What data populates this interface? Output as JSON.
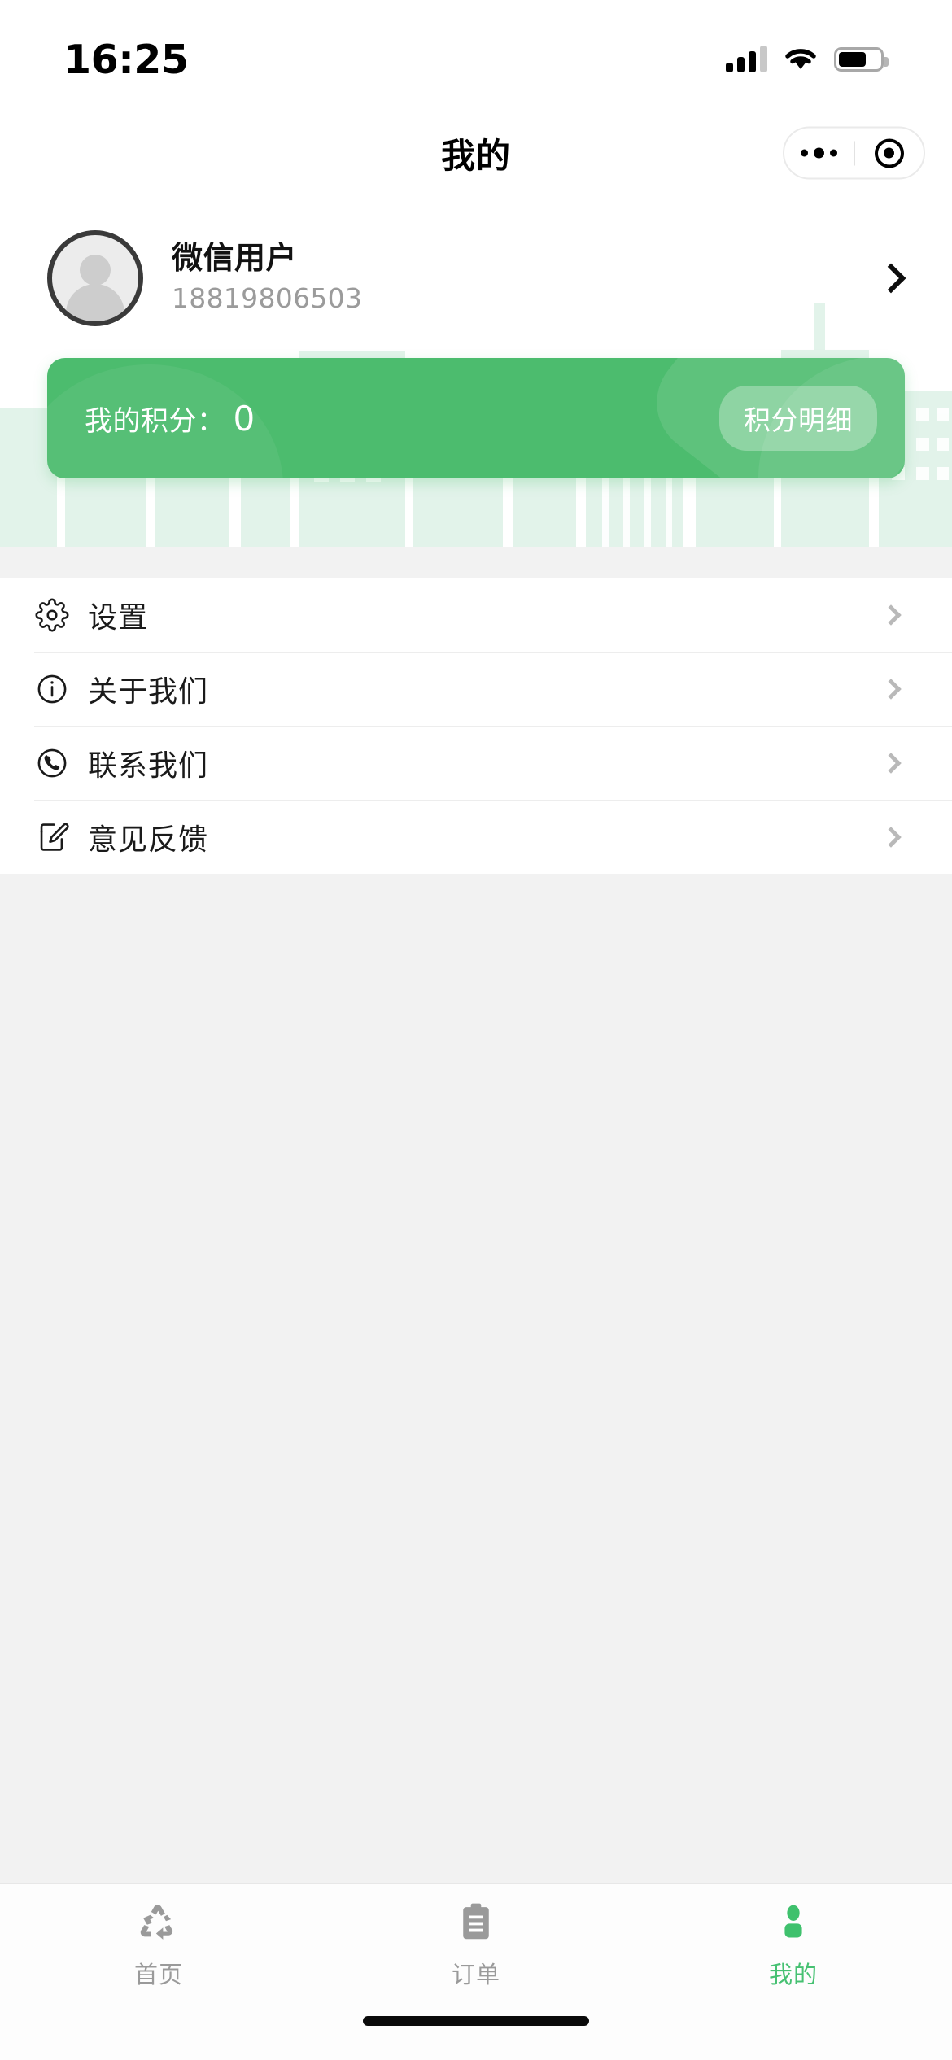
{
  "status_bar": {
    "time": "16:25",
    "signal_icon": "cellular-signal-icon",
    "wifi_icon": "wifi-icon",
    "battery_icon": "battery-icon"
  },
  "nav_bar": {
    "title": "我的",
    "capsule": {
      "more_icon": "more-dots-icon",
      "target_icon": "target-circle-icon"
    }
  },
  "profile": {
    "avatar_icon": "default-user-avatar-icon",
    "name": "微信用户",
    "phone": "18819806503",
    "chevron_icon": "chevron-right-icon"
  },
  "points_card": {
    "label": "我的积分：",
    "value": "0",
    "detail_button": "积分明细",
    "background_color": "#4cbc6e"
  },
  "menu": {
    "items": [
      {
        "label": "设置",
        "icon": "gear-icon",
        "chevron": "chevron-right-icon"
      },
      {
        "label": "关于我们",
        "icon": "info-icon",
        "chevron": "chevron-right-icon"
      },
      {
        "label": "联系我们",
        "icon": "phone-icon",
        "chevron": "chevron-right-icon"
      },
      {
        "label": "意见反馈",
        "icon": "edit-note-icon",
        "chevron": "chevron-right-icon"
      }
    ]
  },
  "tab_bar": {
    "active_color": "#46c172",
    "inactive_color": "#9a9a9a",
    "tabs": [
      {
        "label": "首页",
        "icon": "recycle-icon",
        "active": false
      },
      {
        "label": "订单",
        "icon": "clipboard-icon",
        "active": false
      },
      {
        "label": "我的",
        "icon": "person-icon",
        "active": true
      }
    ]
  },
  "background": {
    "watermark_icon": "city-skyline-watermark"
  }
}
